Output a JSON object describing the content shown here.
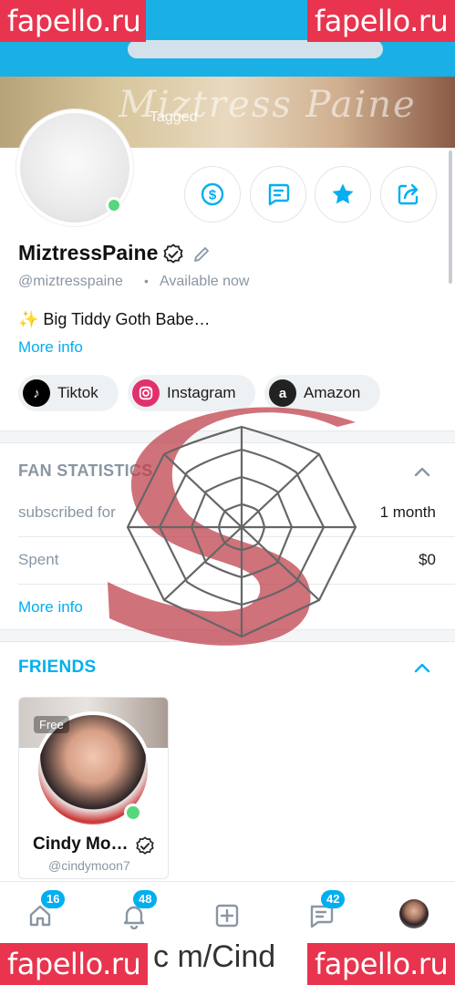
{
  "watermark": {
    "text": "fapello.ru",
    "overlay_url": "c m/Cind"
  },
  "banner": {
    "title": "Miztress Paine",
    "tab_label": "Tagged"
  },
  "profile": {
    "name": "MiztressPaine",
    "handle": "@miztresspaine",
    "separator": "•",
    "availability": "Available now",
    "bio": "✨ Big Tiddy Goth Babe…",
    "more_info": "More info"
  },
  "actions": [
    {
      "icon": "dollar-icon"
    },
    {
      "icon": "message-icon"
    },
    {
      "icon": "star-icon"
    },
    {
      "icon": "share-icon"
    }
  ],
  "social": [
    {
      "label": "Tiktok",
      "icon": "tiktok-icon",
      "color": "#000000"
    },
    {
      "label": "Instagram",
      "icon": "instagram-icon",
      "color": "#e1306c"
    },
    {
      "label": "Amazon",
      "icon": "amazon-icon",
      "color": "#222222"
    }
  ],
  "fan_statistics": {
    "title": "FAN STATISTICS",
    "rows": [
      {
        "label": "subscribed for",
        "value": "1 month"
      },
      {
        "label": "Spent",
        "value": "$0"
      }
    ],
    "more_info": "More info"
  },
  "friends": {
    "title": "FRIENDS",
    "items": [
      {
        "name": "Cindy Mo…",
        "handle": "@cindymoon7",
        "badge": "Free"
      }
    ]
  },
  "bottom_nav": {
    "home_badge": "16",
    "notifications_badge": "48",
    "messages_badge": "42"
  },
  "colors": {
    "accent": "#00aff0",
    "online": "#57d67b",
    "muted": "#8a96a3",
    "watermark": "#e8344e"
  }
}
